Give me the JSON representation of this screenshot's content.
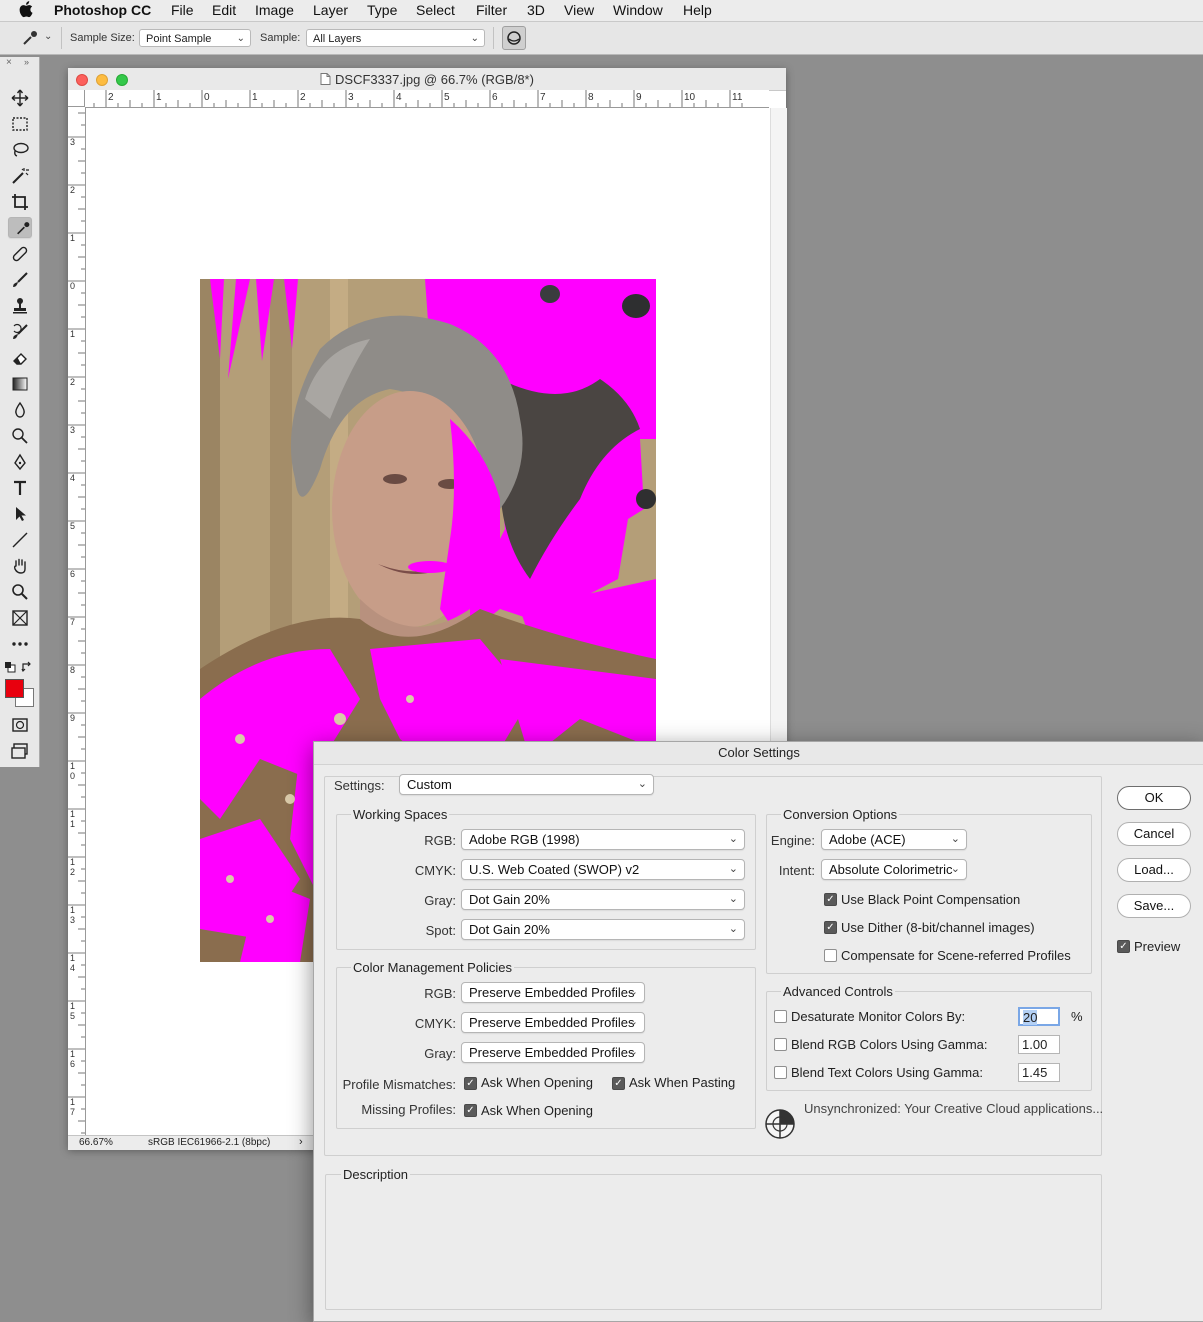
{
  "menubar": {
    "app_name": "Photoshop CC",
    "items": [
      "File",
      "Edit",
      "Image",
      "Layer",
      "Type",
      "Select",
      "Filter",
      "3D",
      "View",
      "Window",
      "Help"
    ]
  },
  "options_bar": {
    "sample_size_label": "Sample Size:",
    "sample_size_value": "Point Sample",
    "sample_label": "Sample:",
    "sample_value": "All Layers"
  },
  "toolbar": {
    "tools": [
      "move-tool",
      "marquee-tool",
      "lasso-tool",
      "magic-wand-tool",
      "crop-tool",
      "eyedropper-tool",
      "healing-brush-tool",
      "brush-tool",
      "clone-stamp-tool",
      "history-brush-tool",
      "eraser-tool",
      "gradient-tool",
      "blur-tool",
      "dodge-tool",
      "pen-tool",
      "type-tool",
      "path-selection-tool",
      "line-tool",
      "hand-tool",
      "zoom-tool",
      "frame-tool",
      "more-tools"
    ],
    "selected_tool": "eyedropper-tool",
    "foreground_color": "#e8000e",
    "background_color": "#ffffff"
  },
  "document": {
    "title": "DSCF3337.jpg @ 66.7% (RGB/8*)",
    "zoom": "66.67%",
    "profile": "sRGB IEC61966-2.1 (8bpc)",
    "hruler_labels": [
      "2",
      "1",
      "0",
      "1",
      "2",
      "3",
      "4",
      "5",
      "6",
      "7",
      "8",
      "9",
      "10",
      "11"
    ],
    "vruler_labels": [
      "3",
      "2",
      "1",
      "0",
      "1",
      "2",
      "3",
      "4",
      "5",
      "6",
      "7",
      "8",
      "9",
      "1\n0",
      "1\n1",
      "1\n2",
      "1\n3",
      "1\n4",
      "1\n5",
      "1\n6",
      "1\n7"
    ],
    "gamut_warning_color": "#ff00ff"
  },
  "dialog": {
    "title": "Color Settings",
    "settings_label": "Settings:",
    "settings_value": "Custom",
    "working_spaces": {
      "title": "Working Spaces",
      "rgb_label": "RGB:",
      "rgb_value": "Adobe RGB (1998)",
      "cmyk_label": "CMYK:",
      "cmyk_value": "U.S. Web Coated (SWOP) v2",
      "gray_label": "Gray:",
      "gray_value": "Dot Gain 20%",
      "spot_label": "Spot:",
      "spot_value": "Dot Gain 20%"
    },
    "policies": {
      "title": "Color Management Policies",
      "rgb_label": "RGB:",
      "rgb_value": "Preserve Embedded Profiles",
      "cmyk_label": "CMYK:",
      "cmyk_value": "Preserve Embedded Profiles",
      "gray_label": "Gray:",
      "gray_value": "Preserve Embedded Profiles",
      "mismatch_label": "Profile Mismatches:",
      "ask_opening": "Ask When Opening",
      "ask_pasting": "Ask When Pasting",
      "missing_label": "Missing Profiles:",
      "missing_ask_opening": "Ask When Opening"
    },
    "conversion": {
      "title": "Conversion Options",
      "engine_label": "Engine:",
      "engine_value": "Adobe (ACE)",
      "intent_label": "Intent:",
      "intent_value": "Absolute Colorimetric",
      "black_point": "Use Black Point Compensation",
      "dither": "Use Dither (8-bit/channel images)",
      "scene_referred": "Compensate for Scene-referred Profiles"
    },
    "advanced": {
      "title": "Advanced Controls",
      "desaturate": "Desaturate Monitor Colors By:",
      "desaturate_value": "20",
      "percent": "%",
      "blend_rgb": "Blend RGB Colors Using Gamma:",
      "blend_rgb_value": "1.00",
      "blend_text": "Blend Text Colors Using Gamma:",
      "blend_text_value": "1.45"
    },
    "sync_message": "Unsynchronized: Your Creative Cloud applications...",
    "description_title": "Description",
    "buttons": {
      "ok": "OK",
      "cancel": "Cancel",
      "load": "Load...",
      "save": "Save..."
    },
    "preview_label": "Preview",
    "checks": {
      "ask_opening": true,
      "ask_pasting": true,
      "missing_ask_opening": true,
      "black_point": true,
      "dither": true,
      "scene_referred": false,
      "desaturate": false,
      "blend_rgb": false,
      "blend_text": false,
      "preview": true
    }
  }
}
